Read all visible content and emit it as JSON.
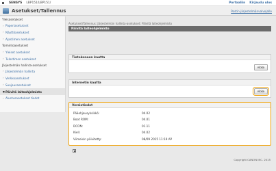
{
  "topbar": {
    "brand": "SENSYS",
    "model": "LBP151/LBP151/",
    "portal_link": "Portaaliin",
    "logout_link": "Kirjaudu ulos"
  },
  "header": {
    "title": "Asetukset/Tallennus",
    "main_link": "Postin järjestelmänvalvojalle"
  },
  "sidebar": {
    "groups": [
      {
        "label": "Yleisasetukset",
        "items": [
          "Paperiasetukset",
          "Näyttöasetukset",
          "Ajastimen asetukset"
        ]
      },
      {
        "label": "Toimintoasetukset",
        "items": [
          "Yleiset asetukset",
          "Tulostimen asetukset"
        ]
      },
      {
        "label": "Järjestelmän hallinta-asetukset",
        "items": [
          "Järjestelmän hallinta",
          "Verkkoasetukset",
          "Suojausasetukset",
          "Päivitä laiteohjelmisto",
          "Alustusasetukset tiedot"
        ]
      }
    ]
  },
  "content": {
    "breadcrumb": "Asetukset/Tallennus: Järjestelmän hallinta-asetukset: Päivitä laiteohjelmisto",
    "page_title": "Päivitä laiteohjelmisto",
    "panel1": {
      "title": "Tietokoneen kautta",
      "button": "Aloita"
    },
    "panel2": {
      "title": "Internetin kautta",
      "button": "Aloita"
    },
    "version_panel": {
      "title": "Versiotiedot",
      "rows": [
        {
          "label": "Pääohjausyksikkö:",
          "value": "04.02"
        },
        {
          "label": "Boot ROM:",
          "value": "04.01"
        },
        {
          "label": "DCON:",
          "value": "01.11"
        },
        {
          "label": "Kieli:",
          "value": "04.02"
        },
        {
          "label": "Viimeisin päivitetty:",
          "value": "08/09 2015 11:19 AP"
        }
      ]
    },
    "copyright": "Copyright CANON INC. 2015"
  }
}
